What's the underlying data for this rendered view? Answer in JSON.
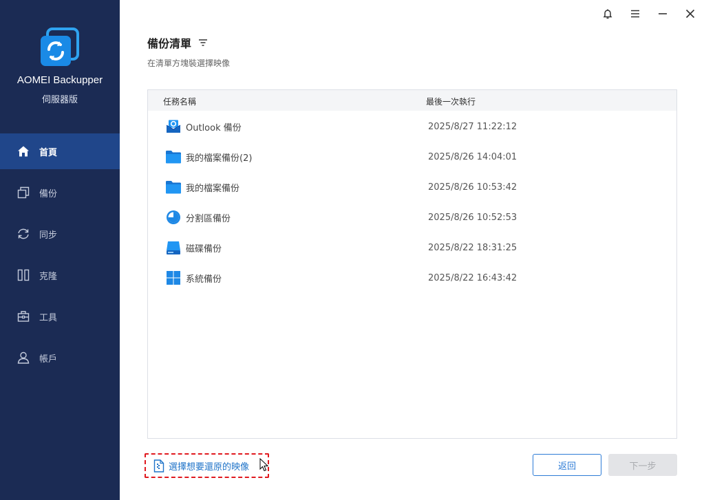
{
  "app": {
    "name": "AOMEI Backupper",
    "edition": "伺服器版"
  },
  "sidebar": {
    "items": [
      {
        "label": "首頁",
        "icon": "home-icon",
        "active": true
      },
      {
        "label": "備份",
        "icon": "backup-icon",
        "active": false
      },
      {
        "label": "同步",
        "icon": "sync-icon",
        "active": false
      },
      {
        "label": "克隆",
        "icon": "clone-icon",
        "active": false
      },
      {
        "label": "工具",
        "icon": "tools-icon",
        "active": false
      },
      {
        "label": "帳戶",
        "icon": "account-icon",
        "active": false
      }
    ]
  },
  "titlebar": {
    "icons": [
      "bell-icon",
      "menu-icon",
      "minimize-icon",
      "close-icon"
    ]
  },
  "header": {
    "title": "備份清單",
    "subtitle": "在清單方塊裝選擇映像"
  },
  "table": {
    "columns": [
      "任務名稱",
      "最後一次執行"
    ],
    "rows": [
      {
        "name": "Outlook 備份",
        "time": "2025/8/27 11:22:12",
        "icon": "outlook-icon"
      },
      {
        "name": "我的檔案備份(2)",
        "time": "2025/8/26 14:04:01",
        "icon": "folder-icon"
      },
      {
        "name": "我的檔案備份",
        "time": "2025/8/26 10:53:42",
        "icon": "folder-icon"
      },
      {
        "name": "分割區備份",
        "time": "2025/8/26 10:52:53",
        "icon": "partition-icon"
      },
      {
        "name": "磁碟備份",
        "time": "2025/8/22 18:31:25",
        "icon": "disk-icon"
      },
      {
        "name": "系統備份",
        "time": "2025/8/22 16:43:42",
        "icon": "windows-icon"
      }
    ]
  },
  "footer": {
    "select_image_label": "選擇想要還原的映像",
    "back_label": "返回",
    "next_label": "下一步"
  },
  "colors": {
    "sidebar_bg": "#1b2b54",
    "sidebar_active": "#20468a",
    "accent": "#2c7bd6",
    "highlight_border": "#e0181e"
  }
}
